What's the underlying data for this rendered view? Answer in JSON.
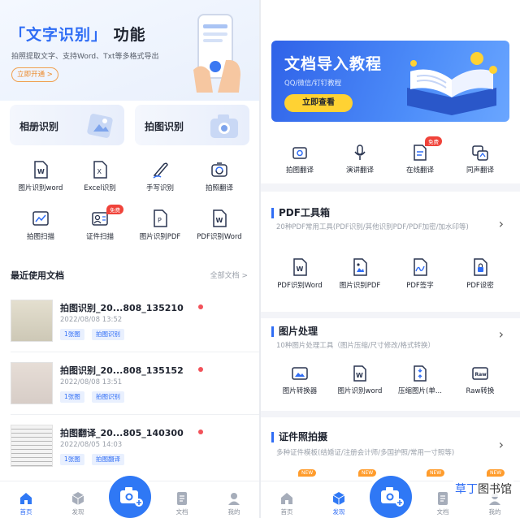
{
  "left": {
    "hero": {
      "title_accent": "「文字识别」",
      "title_rest": "功能",
      "subtitle": "拍照提取文字、支持Word、Txt等多格式导出",
      "cta": "立即开通 >"
    },
    "cards": [
      "相册识别",
      "拍图识别"
    ],
    "tools": [
      {
        "label": "图片识别word",
        "icon": "word-doc-icon"
      },
      {
        "label": "Excel识别",
        "icon": "excel-doc-icon"
      },
      {
        "label": "手写识别",
        "icon": "handwriting-icon"
      },
      {
        "label": "拍照翻译",
        "icon": "photo-translate-icon"
      },
      {
        "label": "拍图扫描",
        "icon": "scan-icon"
      },
      {
        "label": "证件扫描",
        "icon": "id-card-icon",
        "badge": "免费"
      },
      {
        "label": "图片识别PDF",
        "icon": "pdf-doc-icon"
      },
      {
        "label": "PDF识别Word",
        "icon": "pdf-to-word-icon"
      }
    ],
    "recent": {
      "title": "最近使用文档",
      "all_link": "全部文档 >",
      "docs": [
        {
          "name": "拍图识别_20...808_135210",
          "date": "2022/08/08 13:52",
          "tags": [
            "1张图",
            "拍图识别"
          ]
        },
        {
          "name": "拍图识别_20...808_135152",
          "date": "2022/08/08 13:51",
          "tags": [
            "1张图",
            "拍图识别"
          ]
        },
        {
          "name": "拍图翻译_20...805_140300",
          "date": "2022/08/05 14:03",
          "tags": [
            "1张图",
            "拍图翻译"
          ]
        }
      ]
    },
    "tabbar": [
      "首页",
      "发现",
      "文档",
      "我的"
    ]
  },
  "right": {
    "banner": {
      "title": "文档导入教程",
      "subtitle": "QQ/微信/钉钉教程",
      "button": "立即查看"
    },
    "quick": [
      {
        "label": "拍图翻译",
        "icon": "camera-translate-icon"
      },
      {
        "label": "演讲翻译",
        "icon": "microphone-icon"
      },
      {
        "label": "在线翻译",
        "icon": "online-translate-icon",
        "badge": "免费"
      },
      {
        "label": "同声翻译",
        "icon": "simultaneous-translate-icon"
      }
    ],
    "pdf": {
      "title": "PDF工具箱",
      "desc": "20种PDF常用工具(PDF识别/其他识别PDF/PDF加密/加水印等)",
      "items": [
        "PDF识别Word",
        "图片识别PDF",
        "PDF签字",
        "PDF设密"
      ]
    },
    "image": {
      "title": "图片处理",
      "desc": "10种图片处理工具（图片压缩/尺寸修改/格式转换）",
      "items": [
        "图片转换器",
        "图片识别word",
        "压缩图片(单...",
        "Raw转换"
      ]
    },
    "idphoto": {
      "title": "证件照拍摄",
      "desc": "多种证件模板(结婚证/注册会计师/多国护照/常用一寸照等)",
      "new_badge": "NEW"
    },
    "tabbar": [
      "首页",
      "发现",
      "文档",
      "我的"
    ],
    "watermark": {
      "brand": "草丁",
      "rest": "图书馆"
    }
  },
  "colors": {
    "accent": "#2f6df5",
    "fab": "#2f78f5",
    "badge_red": "#f0433a",
    "badge_new": "#ff9c2c",
    "banner_button": "#ffd233"
  }
}
